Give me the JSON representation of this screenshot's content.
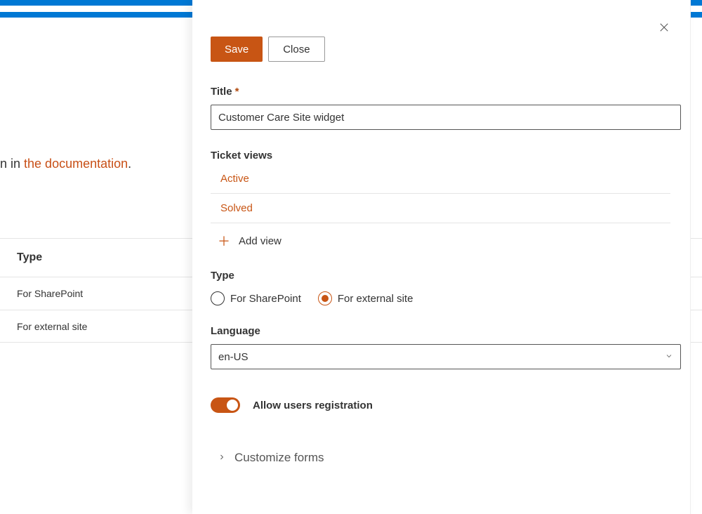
{
  "background": {
    "descSuffix": "n in ",
    "docLink": "the documentation",
    "period": ".",
    "colHeader": "Type",
    "rows": [
      {
        "label": "For SharePoint"
      },
      {
        "label": "For external site"
      }
    ]
  },
  "panel": {
    "buttons": {
      "save": "Save",
      "close": "Close"
    },
    "title": {
      "label": "Title",
      "value": "Customer Care Site widget"
    },
    "ticketViews": {
      "label": "Ticket views",
      "items": [
        "Active",
        "Solved"
      ],
      "addLabel": "Add view"
    },
    "type": {
      "label": "Type",
      "options": [
        {
          "label": "For SharePoint",
          "selected": false
        },
        {
          "label": "For external site",
          "selected": true
        }
      ]
    },
    "language": {
      "label": "Language",
      "value": "en-US"
    },
    "toggle": {
      "label": "Allow users registration",
      "on": true
    },
    "expand": {
      "label": "Customize forms"
    }
  }
}
